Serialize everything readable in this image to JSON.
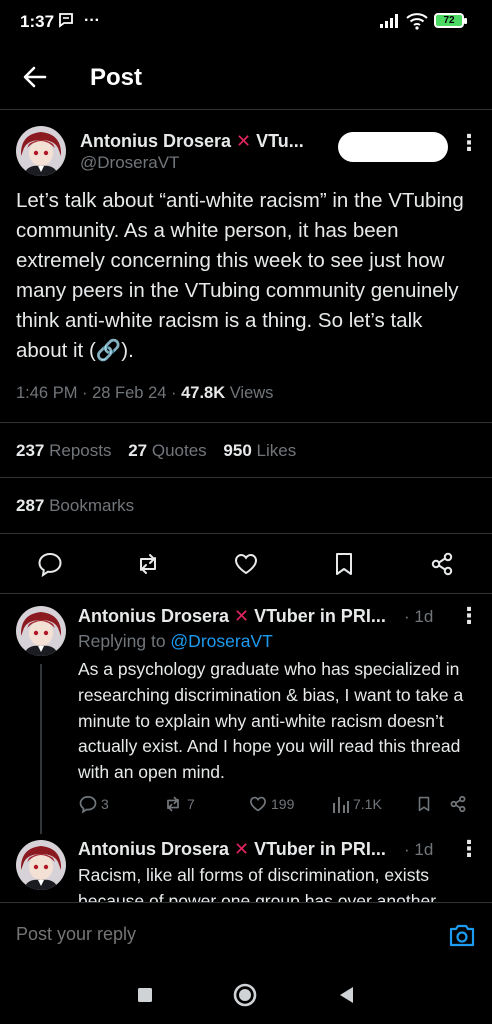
{
  "status_bar": {
    "time": "1:37",
    "battery": "72"
  },
  "header": {
    "title": "Post"
  },
  "main_post": {
    "author": "Antonius Drosera",
    "author_suffix": " VTu...",
    "handle": "@DroseraVT",
    "text": "Let’s talk about “anti-white racism” in the VTubing community. As a white person, it has been extremely concerning this week to see just how many peers in the VTubing community genuinely think anti-white racism is a thing. So let’s talk about it (🔗).",
    "time": "1:46 PM · 28 Feb 24 · ",
    "views_count": "47.8K",
    "views_label": " Views",
    "reposts_count": "237",
    "reposts_label": " Reposts",
    "quotes_count": "27",
    "quotes_label": " Quotes",
    "likes_count": "950",
    "likes_label": " Likes",
    "bookmarks_count": "287",
    "bookmarks_label": " Bookmarks"
  },
  "replies": [
    {
      "author": "Antonius Drosera",
      "author_suffix": " VTuber in PRI...",
      "time": "· 1d",
      "replying_to_label": "Replying to ",
      "replying_to_handle": "@DroseraVT",
      "text": "As a psychology graduate who has specialized in researching discrimination & bias, I want to take a minute to explain why anti-white racism doesn’t actually exist. And I hope you will read this thread with an open mind.",
      "replies_count": "3",
      "reposts_count": "7",
      "likes_count": "199",
      "views_count": "7.1K"
    },
    {
      "author": "Antonius Drosera",
      "author_suffix": " VTuber in PRI...",
      "time": "· 1d",
      "text": "Racism, like all forms of discrimination, exists because of power one group has over another"
    }
  ],
  "reply_bar": {
    "placeholder": "Post your reply"
  },
  "icons": {
    "back": "arrow-left-icon",
    "more": "more-vertical-icon",
    "reply": "comment-icon",
    "repost": "repost-icon",
    "like": "heart-icon",
    "bookmark": "bookmark-icon",
    "share": "share-icon",
    "views": "bar-chart-icon",
    "camera": "camera-icon"
  },
  "colors": {
    "accent": "#1d9bf0",
    "x_mark": "#e0245e",
    "background": "#000000",
    "muted": "#71767b"
  }
}
